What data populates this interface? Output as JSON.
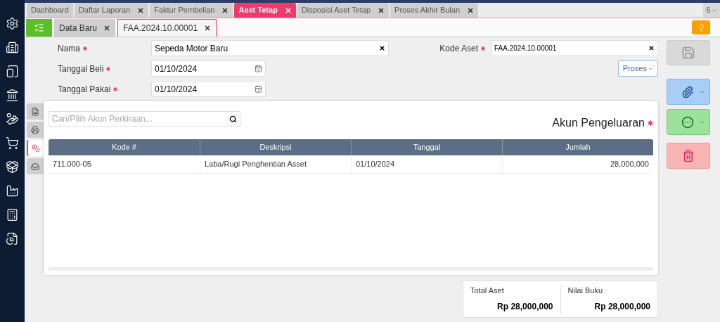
{
  "top_tabs": [
    {
      "label": "Dashboard",
      "selected": false,
      "closable": false
    },
    {
      "label": "Daftar Laporan",
      "selected": false,
      "closable": true
    },
    {
      "label": "Faktur Pembelian",
      "selected": false,
      "closable": true
    },
    {
      "label": "Aset Tetap",
      "selected": true,
      "closable": true
    },
    {
      "label": "Disposisi Aset Tetap",
      "selected": false,
      "closable": true
    },
    {
      "label": "Proses Akhir Bulan",
      "selected": false,
      "closable": true
    }
  ],
  "tab_count": "6",
  "sub_tabs": [
    {
      "label": "Data Baru",
      "selected": false
    },
    {
      "label": "FAA.2024.10.00001",
      "selected": true
    }
  ],
  "form": {
    "nama": {
      "label": "Nama",
      "value": "Sepeda Motor Baru",
      "required": true
    },
    "tanggal_beli": {
      "label": "Tanggal Beli",
      "value": "01/10/2024",
      "required": true
    },
    "tanggal_pakai": {
      "label": "Tanggal Pakai",
      "value": "01/10/2024",
      "required": true
    },
    "kode_aset": {
      "label": "Kode Aset",
      "value": "FAA.2024.10.00001",
      "required": true
    },
    "proses_button": "Proses"
  },
  "side_tabs": [
    {
      "selected": false
    },
    {
      "selected": false
    },
    {
      "selected": true
    },
    {
      "selected": false
    }
  ],
  "panel": {
    "search_placeholder": "Cari/Pilih Akun Perkiraan...",
    "title": "Akun Pengeluaran",
    "title_required": true,
    "columns": [
      "Kode #",
      "Deskripsi",
      "Tanggal",
      "Jumlah"
    ],
    "rows": [
      [
        "711.000-05",
        "Laba/Rugi Penghentian Asset",
        "01/10/2024",
        "28,000,000"
      ]
    ]
  },
  "summary": [
    {
      "label": "Total Aset",
      "value": "Rp 28,000,000"
    },
    {
      "label": "Nilai Buku",
      "value": "Rp 28,000,000"
    }
  ]
}
